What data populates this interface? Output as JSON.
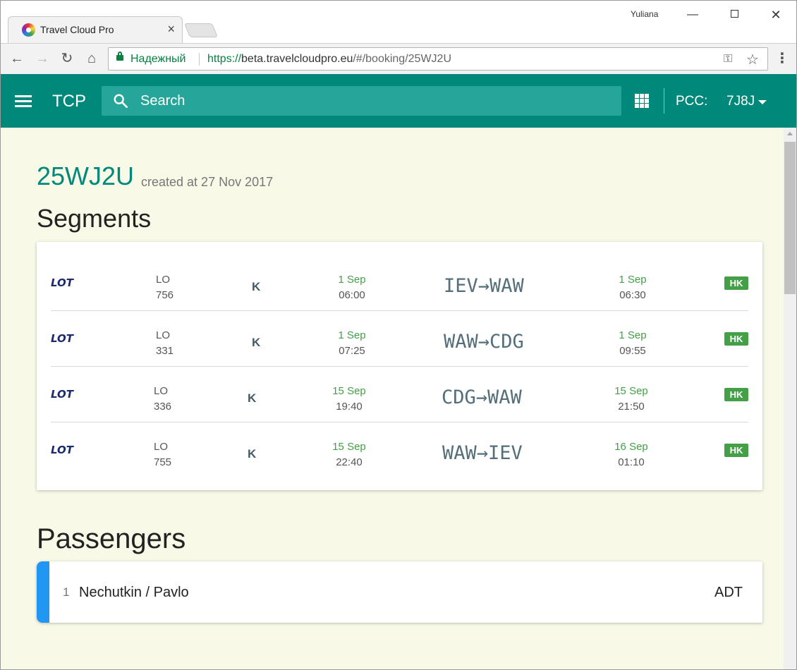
{
  "browser": {
    "tab_title": "Travel Cloud Pro",
    "tab_close": "×",
    "user": "Yuliana",
    "secure_label": "Надежный",
    "url_scheme": "https://",
    "url_host": "beta.travelcloudpro.eu",
    "url_path": "/#/booking/25WJ2U"
  },
  "appbar": {
    "title": "TCP",
    "search_placeholder": "Search",
    "pcc_label": "PCC:",
    "pcc_value": "7J8J"
  },
  "booking": {
    "pnr": "25WJ2U",
    "created": "created at 27 Nov 2017"
  },
  "segments_heading": "Segments",
  "segments": [
    {
      "airline": "LO",
      "flight": "756",
      "class": "K",
      "dep_date": "1 Sep",
      "dep_time": "06:00",
      "route": "IEV→WAW",
      "arr_date": "1 Sep",
      "arr_time": "06:30",
      "status": "HK"
    },
    {
      "airline": "LO",
      "flight": "331",
      "class": "K",
      "dep_date": "1 Sep",
      "dep_time": "07:25",
      "route": "WAW→CDG",
      "arr_date": "1 Sep",
      "arr_time": "09:55",
      "status": "HK"
    },
    {
      "airline": "LO",
      "flight": "336",
      "class": "K",
      "dep_date": "15 Sep",
      "dep_time": "19:40",
      "route": "CDG→WAW",
      "arr_date": "15 Sep",
      "arr_time": "21:50",
      "status": "HK"
    },
    {
      "airline": "LO",
      "flight": "755",
      "class": "K",
      "dep_date": "15 Sep",
      "dep_time": "22:40",
      "route": "WAW→IEV",
      "arr_date": "16 Sep",
      "arr_time": "01:10",
      "status": "HK"
    }
  ],
  "passengers_heading": "Passengers",
  "passengers": [
    {
      "number": "1",
      "name": "Nechutkin / Pavlo",
      "type": "ADT"
    }
  ],
  "colors": {
    "appbar": "#00897b",
    "search_bg": "#26a69a",
    "content_bg": "#f8f9e7",
    "status_hk": "#43a047",
    "passenger_accent": "#2196f3"
  },
  "icons": {
    "airline_logo": "lot-logo-icon",
    "menu": "hamburger-icon",
    "search": "search-icon",
    "apps": "apps-grid-icon",
    "dropdown": "caret-down-icon"
  }
}
